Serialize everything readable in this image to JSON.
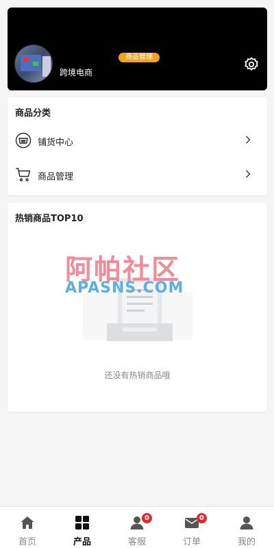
{
  "header": {
    "shop_name": "跨境电商",
    "badge": "商品管理"
  },
  "categories": {
    "title": "商品分类",
    "items": [
      {
        "label": "铺货中心",
        "icon": "basket-icon"
      },
      {
        "label": "商品管理",
        "icon": "cart-icon"
      }
    ]
  },
  "hot": {
    "title": "热销商品TOP10",
    "empty_text": "还没有热销商品哦",
    "watermark_cn": "阿帕社区",
    "watermark_en": "APASNS.COM"
  },
  "tabbar": {
    "items": [
      {
        "label": "首页",
        "icon": "home-icon"
      },
      {
        "label": "产品",
        "icon": "grid-icon"
      },
      {
        "label": "客服",
        "icon": "user-icon",
        "count": "0"
      },
      {
        "label": "订单",
        "icon": "mail-icon",
        "count": "0"
      },
      {
        "label": "我的",
        "icon": "profile-icon"
      }
    ],
    "active_index": 1
  }
}
